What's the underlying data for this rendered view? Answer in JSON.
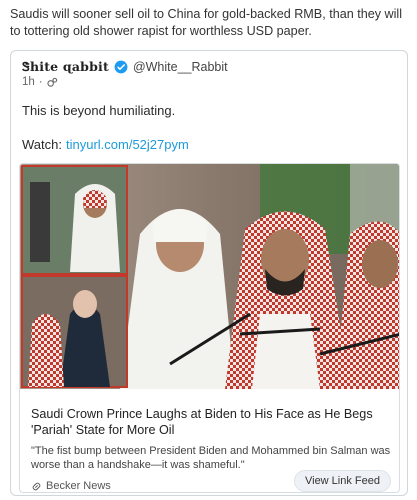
{
  "post": {
    "text": "Saudis will sooner sell oil to China for gold-backed RMB, than they will to tottering old shower rapist for worthless USD paper."
  },
  "embed": {
    "author": {
      "display_name": "Ꮥhite ɋabbit",
      "handle": "@White__Rabbit",
      "verified": true
    },
    "meta": {
      "time": "1h",
      "separator": "·"
    },
    "tweet": {
      "line1": "This is beyond humiliating.",
      "watch_label": "Watch:",
      "watch_link": "tinyurl.com/52j27pym"
    },
    "card": {
      "title": "Saudi Crown Prince Laughs at Biden to His Face as He Begs 'Pariah' State for More Oil",
      "description": "\"The fist bump between President Biden and Mohammed bin Salman was worse than a handshake—it was shameful.\"",
      "source": "Becker News",
      "button_label": "View Link Feed"
    }
  },
  "colors": {
    "link": "#1d9bd9",
    "verified": "#1d9bf0",
    "inset_border": "#c0392b"
  }
}
